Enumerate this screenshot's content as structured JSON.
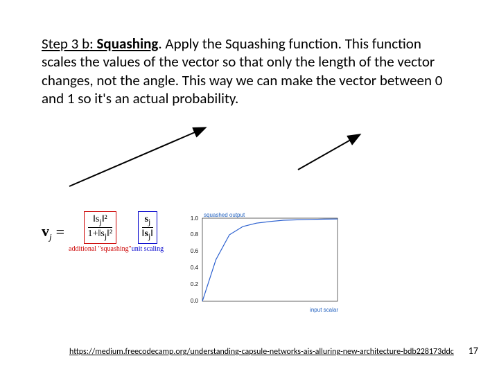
{
  "step_label": "Step 3 b",
  "squash_title": "Squashing",
  "paragraph_rest": ".  Apply the Squashing function.  This function scales the values of the vector so that only the length of the vector changes, not the angle. This way we can make the vector between 0 and 1 so it's an actual probability.",
  "formula": {
    "vj": "v",
    "vj_sub": "j",
    "eq": "=",
    "num_a": "‖s",
    "sub_j": "j",
    "norm_sq": "‖²",
    "den_a_pre": "1+",
    "caption_a": "additional \"squashing\"",
    "num_b_norm": "‖",
    "caption_b": "unit scaling"
  },
  "chart_data": {
    "type": "line",
    "title": "",
    "xlabel": "input scalar",
    "ylabel": "squashed output",
    "x": [
      0,
      1,
      2,
      3,
      4,
      5,
      6,
      7,
      8,
      9,
      10
    ],
    "y": [
      0.0,
      0.5,
      0.8,
      0.9,
      0.94,
      0.96,
      0.975,
      0.98,
      0.985,
      0.988,
      0.99
    ],
    "xlim": [
      0,
      10
    ],
    "ylim": [
      0,
      1
    ],
    "yticks": [
      0.0,
      0.2,
      0.4,
      0.6,
      0.8,
      1.0
    ]
  },
  "footer_link": "https://medium.freecodecamp.org/understanding-capsule-networks-ais-alluring-new-architecture-bdb228173ddc",
  "page_number": "17"
}
